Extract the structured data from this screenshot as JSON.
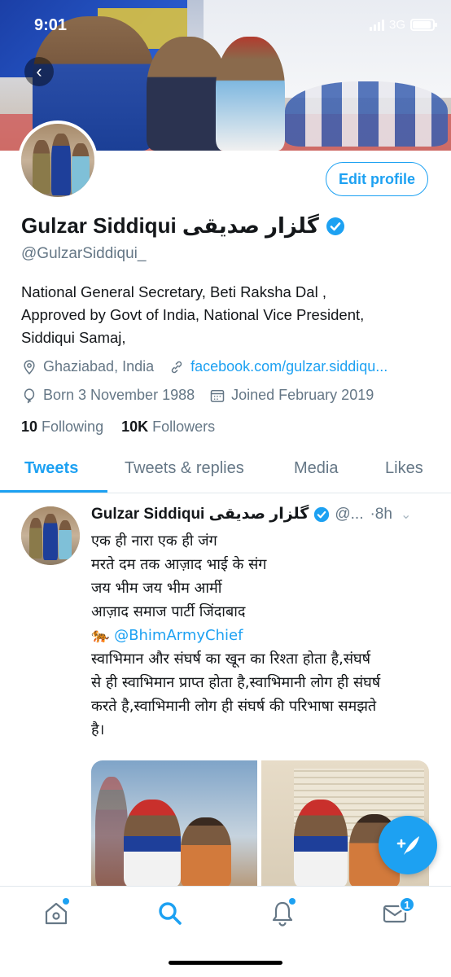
{
  "status_bar": {
    "time": "9:01",
    "network": "3G",
    "battery_level": 0.9
  },
  "profile": {
    "edit_profile_label": "Edit profile",
    "display_name": "Gulzar Siddiqui گلزار صدیقی",
    "handle": "@GulzarSiddiqui_",
    "bio_lines": [
      "National General Secretary, Beti Raksha Dal ,",
      "Approved by Govt of India, National Vice President,",
      "Siddiqui Samaj,"
    ],
    "location": "Ghaziabad, India",
    "website": "facebook.com/gulzar.siddiqu...",
    "birth": "Born 3 November 1988",
    "joined": "Joined February 2019",
    "following_count": "10",
    "following_label": "Following",
    "followers_count": "10K",
    "followers_label": "Followers"
  },
  "tabs": [
    {
      "label": "Tweets",
      "active": true
    },
    {
      "label": "Tweets & replies",
      "active": false
    },
    {
      "label": "Media",
      "active": false
    },
    {
      "label": "Likes",
      "active": false
    }
  ],
  "tweet": {
    "name": "Gulzar Siddiqui گلزار صدیقی",
    "handle": "@...",
    "time": "·8h",
    "lines": [
      "एक ही नारा एक ही जंग",
      "मरते दम तक आज़ाद भाई के संग",
      "जय भीम जय भीम आर्मी",
      "आज़ाद समाज पार्टी जिंदाबाद"
    ],
    "mention_emoji": "🐅",
    "mention": "@BhimArmyChief",
    "body_lines": [
      "स्वाभिमान और संघर्ष का खून का रिश्ता  होता है,संघर्ष",
      "से ही स्वाभिमान प्राप्त होता है,स्वाभिमानी लोग ही संघर्ष",
      "करते है,स्वाभिमानी लोग ही संघर्ष की परिभाषा समझते",
      "है।"
    ]
  },
  "bottom_nav": {
    "messages_badge": "1"
  },
  "colors": {
    "accent": "#1da1f2",
    "text": "#14171a",
    "secondary": "#657786"
  }
}
